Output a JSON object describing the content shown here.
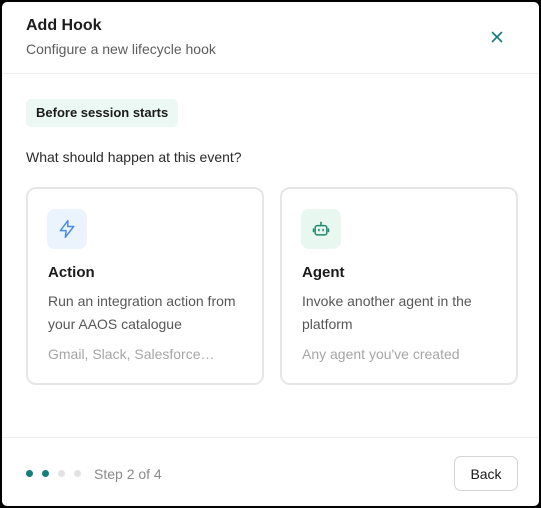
{
  "dialog": {
    "title": "Add Hook",
    "subtitle": "Configure a new lifecycle hook",
    "close_icon": "close-icon"
  },
  "event_badge": "Before session starts",
  "question": "What should happen at this event?",
  "options": [
    {
      "icon": "lightning-bolt-icon",
      "title": "Action",
      "description": "Run an integration action from your AAOS catalogue",
      "examples": "Gmail, Slack, Salesforce…"
    },
    {
      "icon": "robot-icon",
      "title": "Agent",
      "description": "Invoke another agent in the platform",
      "examples": "Any agent you've created"
    }
  ],
  "footer": {
    "step_text": "Step 2 of 4",
    "current_step": 2,
    "total_steps": 4,
    "back_label": "Back"
  },
  "colors": {
    "accent": "#137d7b",
    "action_icon": "#4a90e2",
    "agent_icon": "#1f8a6e",
    "badge_bg": "#ecf8f4"
  }
}
